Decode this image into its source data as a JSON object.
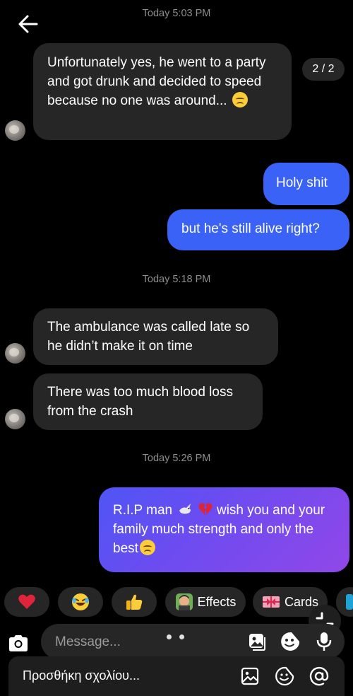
{
  "thread": {
    "timestamps": [
      "Today 5:03 PM",
      "Today 5:18 PM",
      "Today 5:26 PM"
    ],
    "counter": "2 / 2",
    "messages": [
      {
        "sender": "them",
        "text": "Unfortunately yes, he went to a party and got drunk and decided to speed because no one was around... "
      },
      {
        "sender": "me",
        "text": "Holy shit"
      },
      {
        "sender": "me",
        "text": "but he's still alive right?"
      },
      {
        "sender": "them",
        "text": "The ambulance was called late so he didn’t make it on time"
      },
      {
        "sender": "them",
        "text": "There was too much blood loss from the crash"
      },
      {
        "sender": "me",
        "text_a": "R.I.P man",
        "text_b": " wish you and your family much strength and only the best"
      }
    ]
  },
  "reactions": {
    "effects_label": "Effects",
    "cards_label": "Cards"
  },
  "composer": {
    "placeholder": "Message..."
  },
  "comment_bar": {
    "placeholder": "Προσθήκη σχολίου..."
  },
  "colors": {
    "outgoing": "#3a62f7",
    "incoming": "#262626",
    "gradient_start": "#4f55f5",
    "gradient_end": "#9147e8",
    "heart": "#e0243a"
  }
}
